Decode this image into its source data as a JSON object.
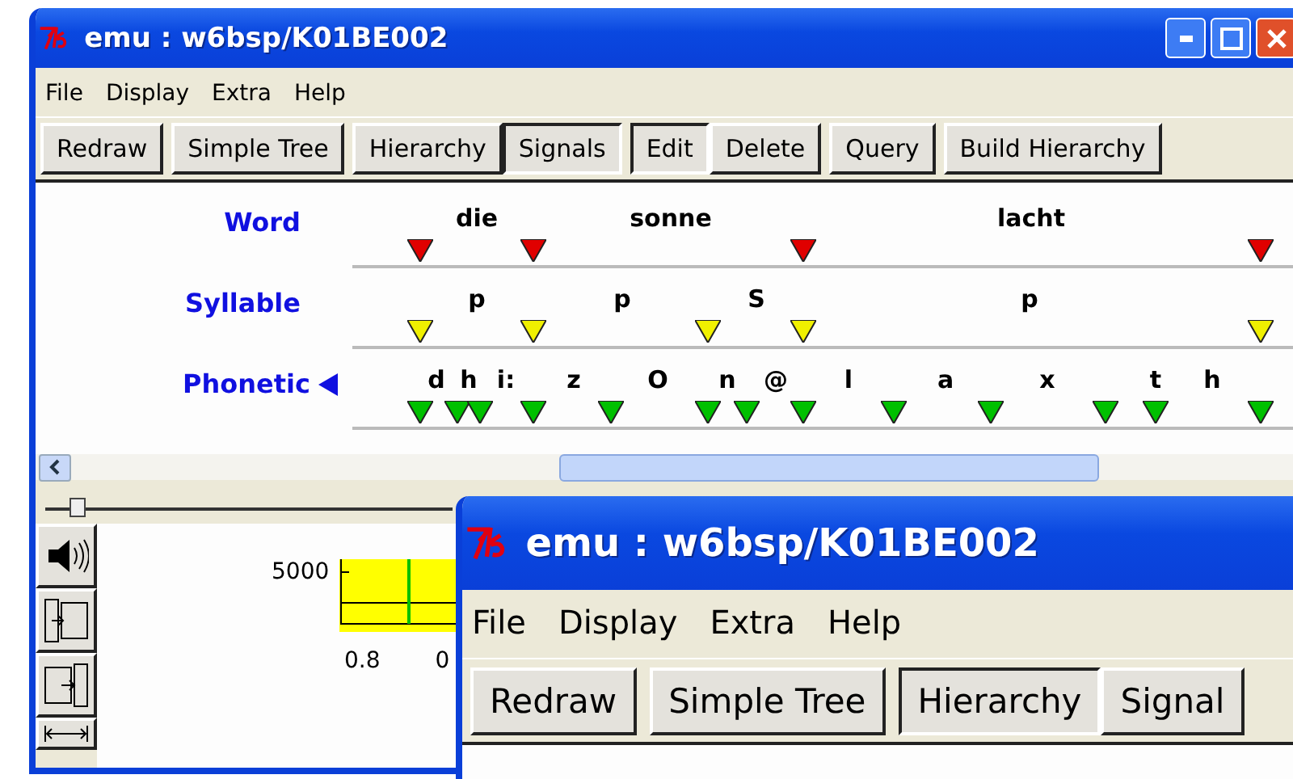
{
  "main_window": {
    "title": "emu : w6bsp/K01BE002",
    "menu": [
      "File",
      "Display",
      "Extra",
      "Help"
    ],
    "toolbar": [
      [
        {
          "label": "Redraw",
          "selected": false
        }
      ],
      [
        {
          "label": "Simple Tree",
          "selected": false
        }
      ],
      [
        {
          "label": "Hierarchy",
          "selected": false
        },
        {
          "label": "Signals",
          "selected": true
        }
      ],
      [
        {
          "label": "Edit",
          "selected": true
        },
        {
          "label": "Delete",
          "selected": false
        }
      ],
      [
        {
          "label": "Query",
          "selected": false
        }
      ],
      [
        {
          "label": "Build Hierarchy",
          "selected": false
        }
      ]
    ],
    "tiers": [
      {
        "name": "Word",
        "color": "#e00000",
        "selected": false,
        "labels": [
          "die",
          "sonne",
          "lacht"
        ]
      },
      {
        "name": "Syllable",
        "color": "#f0f000",
        "selected": false,
        "labels": [
          "p",
          "p",
          "S",
          "p"
        ]
      },
      {
        "name": "Phonetic",
        "color": "#00c000",
        "selected": true,
        "labels": [
          "d",
          "h",
          "i:",
          "z",
          "O",
          "n",
          "@",
          "l",
          "a",
          "x",
          "t",
          "h"
        ]
      }
    ],
    "slider": {
      "level": 0.06
    },
    "spectrogram": {
      "y_tick": "5000",
      "x_ticks": [
        "0.8",
        "0"
      ]
    }
  },
  "front_window": {
    "title": "emu : w6bsp/K01BE002",
    "menu": [
      "File",
      "Display",
      "Extra",
      "Help"
    ],
    "toolbar": [
      [
        {
          "label": "Redraw",
          "selected": false
        }
      ],
      [
        {
          "label": "Simple Tree",
          "selected": false
        }
      ],
      [
        {
          "label": "Hierarchy",
          "selected": true
        },
        {
          "label": "Signal",
          "selected": false
        }
      ]
    ]
  }
}
